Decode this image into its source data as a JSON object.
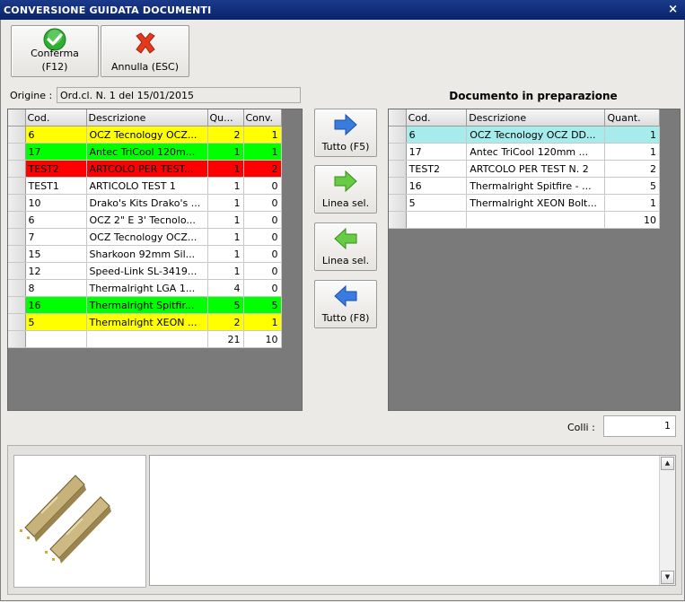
{
  "window": {
    "title": "CONVERSIONE GUIDATA DOCUMENTI",
    "close_glyph": "×"
  },
  "toolbar": {
    "confirm_label_1": "Conferma",
    "confirm_label_2": "(F12)",
    "cancel_label": "Annulla (ESC)"
  },
  "origin": {
    "label": "Origine :",
    "value": "Ord.cl. N. 1 del 15/01/2015"
  },
  "dest": {
    "title": "Documento in preparazione"
  },
  "left_grid": {
    "headers": [
      "Cod.",
      "Descrizione",
      "Qu...",
      "Conv."
    ],
    "rows": [
      {
        "cod": "6",
        "desc": "OCZ Tecnology OCZ...",
        "qty": "2",
        "conv": "1",
        "color": "yellow"
      },
      {
        "cod": "17",
        "desc": "Antec TriCool 120m...",
        "qty": "1",
        "conv": "1",
        "color": "green"
      },
      {
        "cod": "TEST2",
        "desc": "ARTCOLO PER TEST...",
        "qty": "1",
        "conv": "2",
        "color": "red"
      },
      {
        "cod": "TEST1",
        "desc": "ARTICOLO TEST 1",
        "qty": "1",
        "conv": "0",
        "color": "white"
      },
      {
        "cod": "10",
        "desc": "Drako's Kits Drako's ...",
        "qty": "1",
        "conv": "0",
        "color": "white"
      },
      {
        "cod": "6",
        "desc": "OCZ 2\" E 3' Tecnolo...",
        "qty": "1",
        "conv": "0",
        "color": "white"
      },
      {
        "cod": "7",
        "desc": "OCZ Tecnology OCZ...",
        "qty": "1",
        "conv": "0",
        "color": "white"
      },
      {
        "cod": "15",
        "desc": "Sharkoon 92mm Sil...",
        "qty": "1",
        "conv": "0",
        "color": "white"
      },
      {
        "cod": "12",
        "desc": "Speed-Link SL-3419...",
        "qty": "1",
        "conv": "0",
        "color": "white"
      },
      {
        "cod": "8",
        "desc": "Thermalright LGA 1...",
        "qty": "4",
        "conv": "0",
        "color": "white"
      },
      {
        "cod": "16",
        "desc": "Thermalright Spitfir...",
        "qty": "5",
        "conv": "5",
        "color": "green"
      },
      {
        "cod": "5",
        "desc": "Thermalright XEON ...",
        "qty": "2",
        "conv": "1",
        "color": "yellow"
      }
    ],
    "totals": {
      "qty": "21",
      "conv": "10"
    }
  },
  "middle_buttons": {
    "all_right": "Tutto (F5)",
    "line_right": "Linea sel.",
    "line_left": "Linea sel.",
    "all_left": "Tutto (F8)"
  },
  "right_grid": {
    "headers": [
      "Cod.",
      "Descrizione",
      "Quant."
    ],
    "rows": [
      {
        "cod": "6",
        "desc": "OCZ Tecnology OCZ DD...",
        "qty": "1",
        "color": "cyan"
      },
      {
        "cod": "17",
        "desc": "Antec TriCool 120mm ...",
        "qty": "1",
        "color": "white"
      },
      {
        "cod": "TEST2",
        "desc": "ARTCOLO PER TEST N. 2",
        "qty": "2",
        "color": "white"
      },
      {
        "cod": "16",
        "desc": "Thermalright Spitfire - ...",
        "qty": "5",
        "color": "white"
      },
      {
        "cod": "5",
        "desc": "Thermalright XEON Bolt...",
        "qty": "1",
        "color": "white"
      }
    ],
    "totals": {
      "qty": "10"
    }
  },
  "colli": {
    "label": "Colli :",
    "value": "1"
  },
  "memo": {
    "text": ""
  },
  "icons": {
    "confirm": "check-circle-icon",
    "cancel": "red-x-icon",
    "product": "ram-modules-image"
  },
  "colors": {
    "accent": "#0a246a",
    "yellow": "#ffff00",
    "green": "#00ff00",
    "red": "#ff0000",
    "selected": "#a6ecec"
  }
}
